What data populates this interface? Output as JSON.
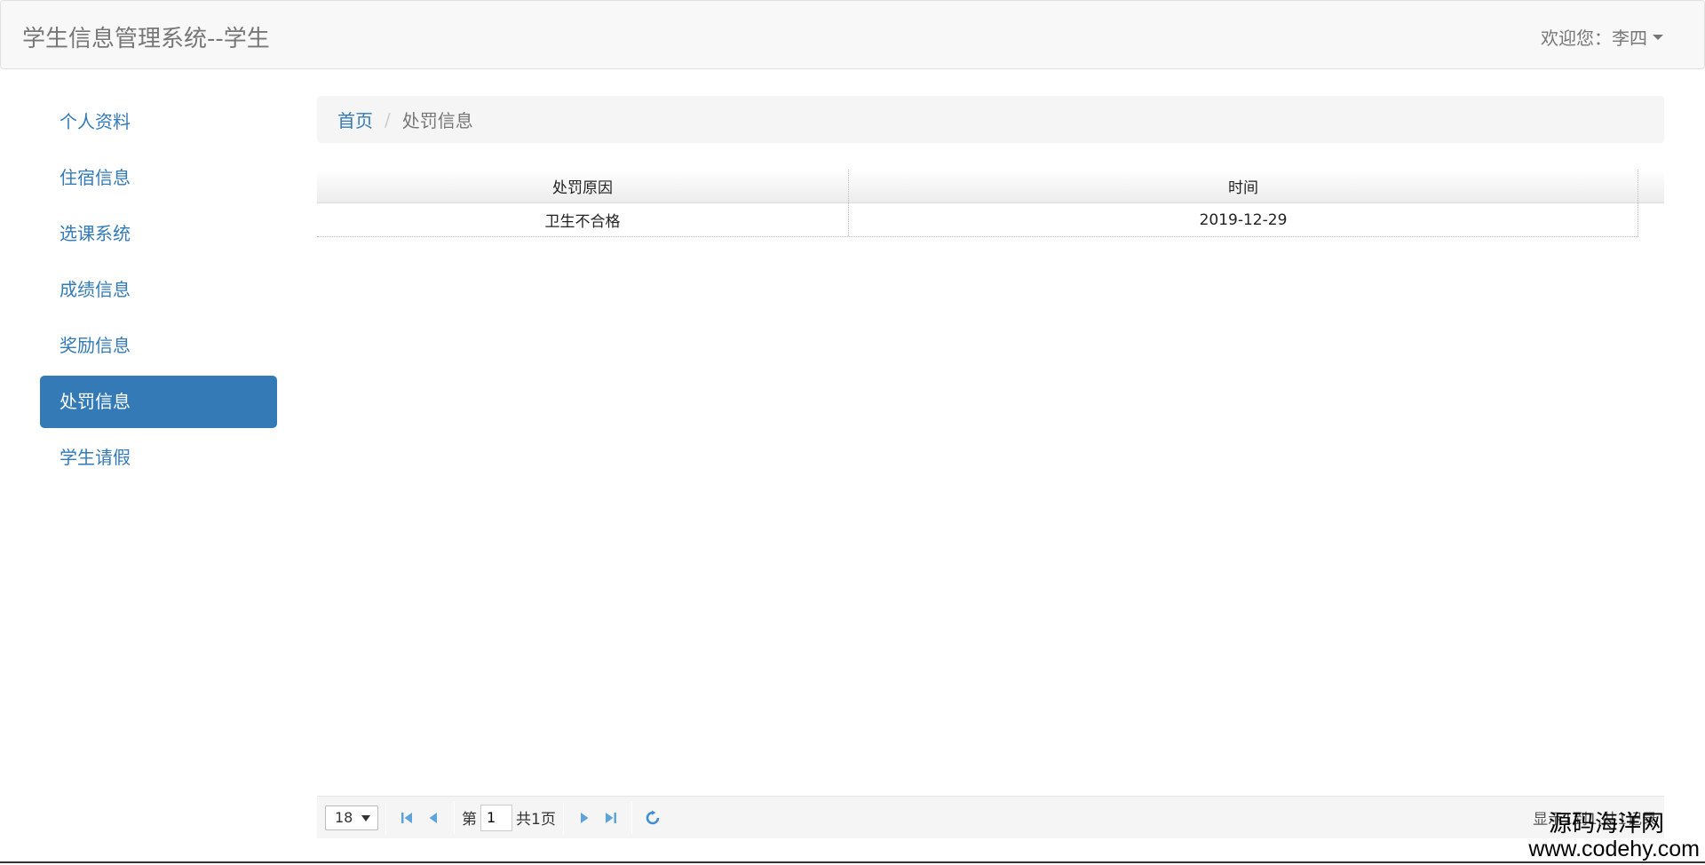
{
  "navbar": {
    "brand": "学生信息管理系统--学生",
    "welcome": "欢迎您：李四"
  },
  "sidebar": {
    "items": [
      {
        "label": "个人资料",
        "active": false
      },
      {
        "label": "住宿信息",
        "active": false
      },
      {
        "label": "选课系统",
        "active": false
      },
      {
        "label": "成绩信息",
        "active": false
      },
      {
        "label": "奖励信息",
        "active": false
      },
      {
        "label": "处罚信息",
        "active": true
      },
      {
        "label": "学生请假",
        "active": false
      }
    ]
  },
  "breadcrumb": {
    "home": "首页",
    "separator": "/",
    "current": "处罚信息"
  },
  "table": {
    "columns": [
      "处罚原因",
      "时间"
    ],
    "rows": [
      [
        "卫生不合格",
        "2019-12-29"
      ]
    ]
  },
  "pager": {
    "page_size": "18",
    "page_prefix": "第",
    "page_value": "1",
    "total_pages": "共1页",
    "info": "显示1到1,共1记录"
  },
  "watermark": {
    "line1": "源码海洋网",
    "line2": "www.codehy.com"
  },
  "colors": {
    "accent": "#337ab7",
    "pager_icon": "#5ea4d8"
  }
}
